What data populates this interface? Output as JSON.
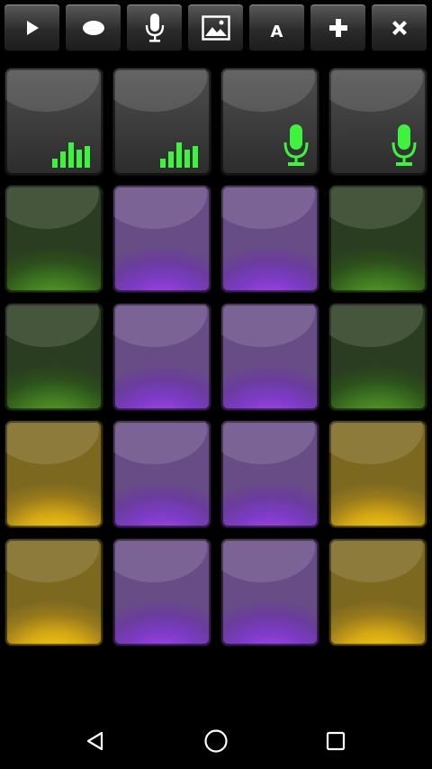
{
  "toolbar": {
    "buttons": [
      {
        "name": "play-icon"
      },
      {
        "name": "record-icon"
      },
      {
        "name": "microphone-icon"
      },
      {
        "name": "image-icon"
      },
      {
        "name": "font-icon",
        "glyph": "A"
      },
      {
        "name": "add-icon"
      },
      {
        "name": "close-icon"
      }
    ]
  },
  "pads": {
    "columns": 4,
    "rows": [
      [
        "gray",
        "gray",
        "gray",
        "gray"
      ],
      [
        "green",
        "purple",
        "purple",
        "green"
      ],
      [
        "green",
        "purple",
        "purple",
        "green"
      ],
      [
        "yellow",
        "purple",
        "purple",
        "yellow"
      ],
      [
        "yellow",
        "purple",
        "purple",
        "yellow"
      ]
    ],
    "row1_icons": [
      "equalizer-icon",
      "equalizer-icon",
      "microphone-icon",
      "microphone-icon"
    ]
  },
  "colors": {
    "icon_green": "#3ff23f",
    "pad_green": "#3f7820",
    "pad_purple": "#7d3bc7",
    "pad_yellow": "#d4a714",
    "pad_gray": "#3a3a3a"
  },
  "navbar": {
    "buttons": [
      "back-icon",
      "home-icon",
      "recents-icon"
    ]
  }
}
